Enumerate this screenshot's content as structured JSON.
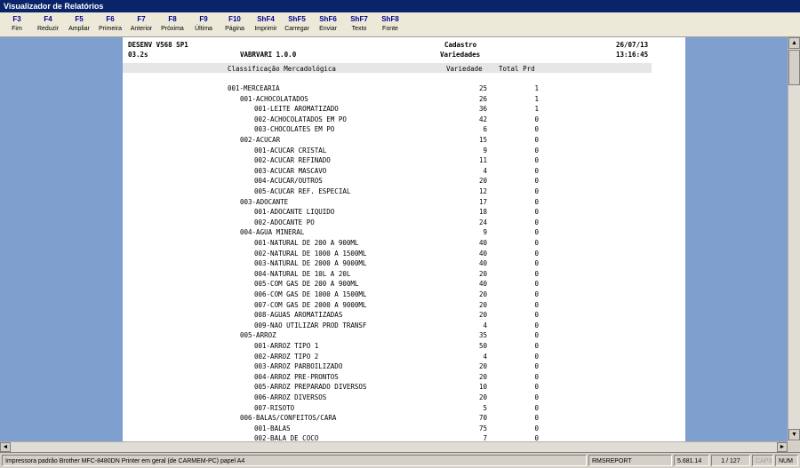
{
  "window": {
    "title": "Visualizador de Relatórios"
  },
  "toolbar": {
    "buttons": [
      {
        "key": "F3",
        "label": "Fim"
      },
      {
        "key": "F4",
        "label": "Reduzir"
      },
      {
        "key": "F5",
        "label": "Ampliar"
      },
      {
        "key": "F6",
        "label": "Primeira"
      },
      {
        "key": "F7",
        "label": "Anterior"
      },
      {
        "key": "F8",
        "label": "Próxima"
      },
      {
        "key": "F9",
        "label": "Última"
      },
      {
        "key": "F10",
        "label": "Página"
      },
      {
        "key": "ShF4",
        "label": "Imprimir"
      },
      {
        "key": "ShF5",
        "label": "Carregar"
      },
      {
        "key": "ShF6",
        "label": "Enviar"
      },
      {
        "key": "ShF7",
        "label": "Texto"
      },
      {
        "key": "ShF8",
        "label": "Fonte"
      }
    ]
  },
  "report": {
    "header": {
      "system": "DESENV V568 SP1",
      "version_code": "03.2s",
      "program": "VABRVARI 1.0.0",
      "section": "Cadastro",
      "subtitle": "Variedades",
      "date": "26/07/13",
      "time": "13:16:45"
    },
    "columns": {
      "classification": "Classificação Mercadológica",
      "variety": "Variedade",
      "total": "Total Prd"
    },
    "rows": [
      {
        "level": 0,
        "label": "001-MERCEARIA",
        "variety": "25",
        "total": "1"
      },
      {
        "level": 1,
        "label": "001-ACHOCOLATADOS",
        "variety": "26",
        "total": "1"
      },
      {
        "level": 2,
        "label": "001-LEITE AROMATIZADO",
        "variety": "36",
        "total": "1"
      },
      {
        "level": 2,
        "label": "002-ACHOCOLATADOS EM PO",
        "variety": "42",
        "total": "0"
      },
      {
        "level": 2,
        "label": "003-CHOCOLATES EM PO",
        "variety": "6",
        "total": "0"
      },
      {
        "level": 1,
        "label": "002-ACUCAR",
        "variety": "15",
        "total": "0"
      },
      {
        "level": 2,
        "label": "001-ACUCAR CRISTAL",
        "variety": "9",
        "total": "0"
      },
      {
        "level": 2,
        "label": "002-ACUCAR REFINADO",
        "variety": "11",
        "total": "0"
      },
      {
        "level": 2,
        "label": "003-ACUCAR MASCAVO",
        "variety": "4",
        "total": "0"
      },
      {
        "level": 2,
        "label": "004-ACUCAR/OUTROS",
        "variety": "20",
        "total": "0"
      },
      {
        "level": 2,
        "label": "005-ACUCAR REF. ESPECIAL",
        "variety": "12",
        "total": "0"
      },
      {
        "level": 1,
        "label": "003-ADOCANTE",
        "variety": "17",
        "total": "0"
      },
      {
        "level": 2,
        "label": "001-ADOCANTE LIQUIDO",
        "variety": "18",
        "total": "0"
      },
      {
        "level": 2,
        "label": "002-ADOCANTE PO",
        "variety": "24",
        "total": "0"
      },
      {
        "level": 1,
        "label": "004-AGUA MINERAL",
        "variety": "9",
        "total": "0"
      },
      {
        "level": 2,
        "label": "001-NATURAL DE 200 A 900ML",
        "variety": "40",
        "total": "0"
      },
      {
        "level": 2,
        "label": "002-NATURAL DE 1000 A 1500ML",
        "variety": "40",
        "total": "0"
      },
      {
        "level": 2,
        "label": "003-NATURAL DE 2000 A 9000ML",
        "variety": "40",
        "total": "0"
      },
      {
        "level": 2,
        "label": "004-NATURAL DE 10L A 20L",
        "variety": "20",
        "total": "0"
      },
      {
        "level": 2,
        "label": "005-COM GAS DE 200 A 900ML",
        "variety": "40",
        "total": "0"
      },
      {
        "level": 2,
        "label": "006-COM GAS DE 1000 A 1500ML",
        "variety": "20",
        "total": "0"
      },
      {
        "level": 2,
        "label": "007-COM GAS DE 2000 A 9000ML",
        "variety": "20",
        "total": "0"
      },
      {
        "level": 2,
        "label": "008-AGUAS AROMATIZADAS",
        "variety": "20",
        "total": "0"
      },
      {
        "level": 2,
        "label": "009-NAO UTILIZAR PROD TRANSF",
        "variety": "4",
        "total": "0"
      },
      {
        "level": 1,
        "label": "005-ARROZ",
        "variety": "35",
        "total": "0"
      },
      {
        "level": 2,
        "label": "001-ARROZ TIPO 1",
        "variety": "50",
        "total": "0"
      },
      {
        "level": 2,
        "label": "002-ARROZ TIPO 2",
        "variety": "4",
        "total": "0"
      },
      {
        "level": 2,
        "label": "003-ARROZ PARBOILIZADO",
        "variety": "20",
        "total": "0"
      },
      {
        "level": 2,
        "label": "004-ARROZ PRE-PRONTOS",
        "variety": "20",
        "total": "0"
      },
      {
        "level": 2,
        "label": "005-ARROZ PREPARADO DIVERSOS",
        "variety": "10",
        "total": "0"
      },
      {
        "level": 2,
        "label": "006-ARROZ DIVERSOS",
        "variety": "20",
        "total": "0"
      },
      {
        "level": 2,
        "label": "007-RISOTO",
        "variety": "5",
        "total": "0"
      },
      {
        "level": 1,
        "label": "006-BALAS/CONFEITOS/CARA",
        "variety": "70",
        "total": "0"
      },
      {
        "level": 2,
        "label": "001-BALAS",
        "variety": "75",
        "total": "0"
      },
      {
        "level": 2,
        "label": "002-BALA DE COCO",
        "variety": "7",
        "total": "0"
      }
    ]
  },
  "scrollbars": {
    "up_arrow": "▲",
    "down_arrow": "▼",
    "left_arrow": "◄",
    "right_arrow": "►"
  },
  "statusbar": {
    "printer": "Impressora padrão Brother MFC-8480DN Printer em geral (de CARMEM-PC) papel A4",
    "report_name": "RMSREPORT",
    "version": "5.681.14",
    "page": "1 / 127",
    "caps": "CAPS",
    "num": "NUM"
  }
}
